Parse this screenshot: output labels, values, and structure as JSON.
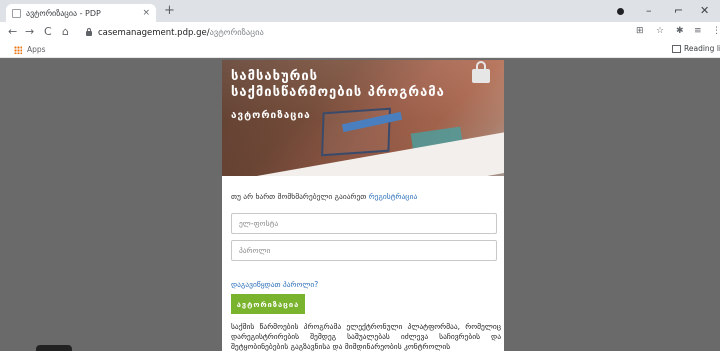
{
  "browser": {
    "tab": {
      "title": "ავტორიზაცია - PDP",
      "close": "×"
    },
    "new_tab": "+",
    "window": {
      "minimize": "–",
      "maximize": "⌐",
      "close": "✕"
    },
    "nav": {
      "back": "←",
      "forward": "→",
      "reload": "C",
      "home": "⌂"
    },
    "url": {
      "host": "casemanagement.pdp.ge/",
      "path": "ავტორიზაცია"
    },
    "toolbar_icons": {
      "translate": "⊞",
      "star": "☆",
      "pin": "✱",
      "profile": "≡",
      "menu": "⋮"
    },
    "bookmarks": {
      "apps_label": "Apps",
      "reading_list": "Reading list"
    }
  },
  "card": {
    "title_line1": "სამსახურის",
    "title_line2": "საქმისწარმოების პროგრამა",
    "subtitle": "ავტორიზაცია",
    "register_prefix": "თუ არ ხართ მომხმარებელი გაიარეთ",
    "register_link": "რეგისტრაცია",
    "email_placeholder": "ელ-ფოსტა",
    "password_placeholder": "პაროლი",
    "forgot_link": "დაგავიწყდათ პაროლი?",
    "login_button": "ავტორიზაცია",
    "description": "საქმის წარმოების პროგრამა ელექტრონული პლატფორმაა, რომელიც დარეგისტრირების შემდეგ საშუალებას იძლევა საჩივრების და შეტყობინებების გაგზავნისა და მიმდინარეობის კონტროლის"
  }
}
